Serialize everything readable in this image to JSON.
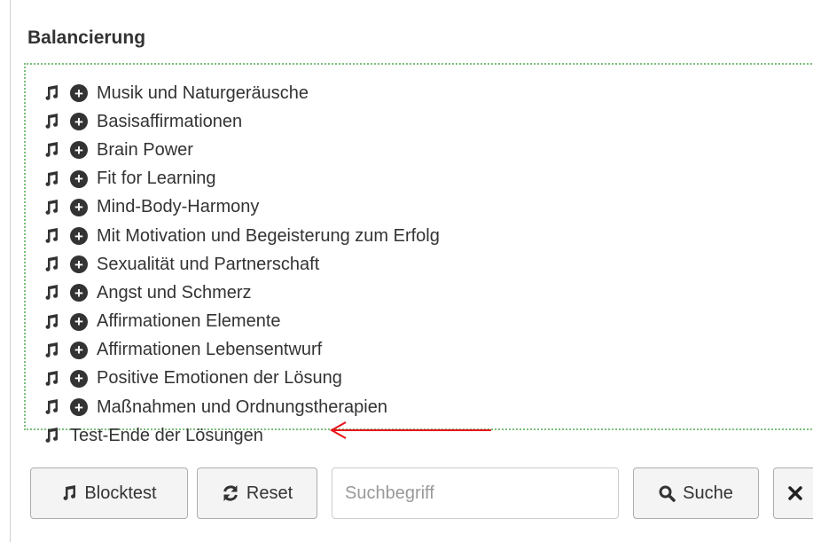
{
  "section": {
    "heading": "Balancierung"
  },
  "tree": {
    "items": [
      {
        "label": "Musik und Naturgeräusche",
        "expandable": true
      },
      {
        "label": "Basisaffirmationen",
        "expandable": true
      },
      {
        "label": "Brain Power",
        "expandable": true
      },
      {
        "label": "Fit for Learning",
        "expandable": true
      },
      {
        "label": "Mind-Body-Harmony",
        "expandable": true
      },
      {
        "label": "Mit Motivation und Begeisterung zum Erfolg",
        "expandable": true
      },
      {
        "label": "Sexualität und Partnerschaft",
        "expandable": true
      },
      {
        "label": "Angst und Schmerz",
        "expandable": true
      },
      {
        "label": "Affirmationen Elemente",
        "expandable": true
      },
      {
        "label": "Affirmationen Lebensentwurf",
        "expandable": true
      },
      {
        "label": "Positive Emotionen der Lösung",
        "expandable": true
      },
      {
        "label": "Maßnahmen und Ordnungstherapien",
        "expandable": true
      },
      {
        "label": "Test-Ende der Lösungen",
        "expandable": false
      }
    ],
    "item_icon": "music-icon",
    "expand_icon": "plus-circle-icon"
  },
  "annotation": {
    "icon": "red-arrow-icon",
    "color": "#e8141a"
  },
  "toolbar": {
    "blocktest_label": "Blocktest",
    "reset_label": "Reset",
    "search_placeholder": "Suchbegriff",
    "search_value": "",
    "suche_label": "Suche",
    "clear_icon": "close-icon"
  },
  "colors": {
    "tree_border": "#7bbf7b",
    "text": "#333333"
  }
}
